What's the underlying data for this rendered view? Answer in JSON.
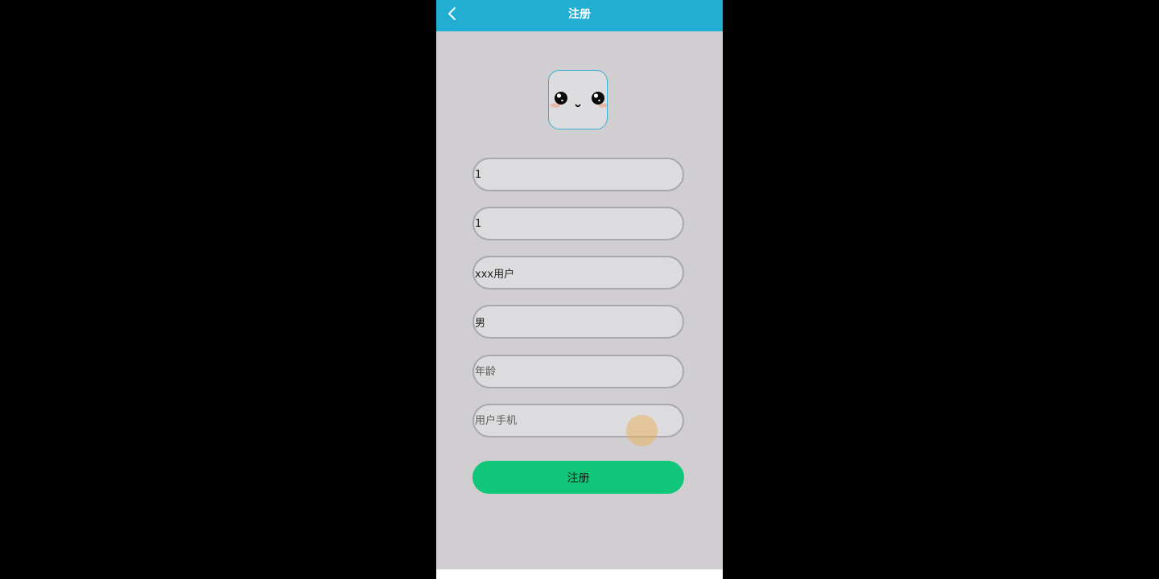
{
  "header": {
    "title": "注册",
    "back_icon": "chevron-left-icon",
    "color": "#22aed3"
  },
  "avatar": {
    "icon": "kawaii-face-icon",
    "border_color": "#3aaed0"
  },
  "form": {
    "username": {
      "value": "1"
    },
    "password": {
      "value": "1"
    },
    "nickname": {
      "value": "xxx用户"
    },
    "gender": {
      "value": "男"
    },
    "age": {
      "value": "",
      "placeholder": "年龄"
    },
    "phone": {
      "value": "",
      "placeholder": "用户手机"
    },
    "submit_label": "注册",
    "submit_color": "#10c679"
  },
  "colors": {
    "screen_background": "#d0ced0",
    "field_border": "#a9a8aa",
    "touch_indicator": "#e8b262"
  }
}
